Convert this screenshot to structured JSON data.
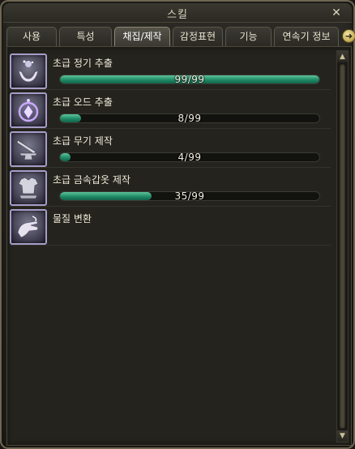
{
  "window": {
    "title": "스킬",
    "close_glyph": "✕"
  },
  "tabs": [
    {
      "label": "사용",
      "active": false
    },
    {
      "label": "특성",
      "active": false
    },
    {
      "label": "채집/제작",
      "active": true
    },
    {
      "label": "감정표현",
      "active": false
    },
    {
      "label": "기능",
      "active": false
    },
    {
      "label": "연속기 정보",
      "active": false
    }
  ],
  "tab_arrow_glyph": "➜",
  "skills": [
    {
      "name": "초급 정기 추출",
      "progress_text": "99/99",
      "level": 99,
      "max": 99,
      "icon": "cupped-hands-icon"
    },
    {
      "name": "초급 오드 추출",
      "progress_text": "8/99",
      "level": 8,
      "max": 99,
      "icon": "odd-crystal-icon"
    },
    {
      "name": "초급 무기 제작",
      "progress_text": "4/99",
      "level": 4,
      "max": 99,
      "icon": "anvil-sword-icon"
    },
    {
      "name": "초급 금속갑옷 제작",
      "progress_text": "35/99",
      "level": 35,
      "max": 99,
      "icon": "plate-armor-icon"
    },
    {
      "name": "물질 변환",
      "icon": "hand-transmute-icon"
    }
  ],
  "scrollbar": {
    "up_glyph": "▲",
    "down_glyph": "▼"
  },
  "colors": {
    "bar_fill": "#1f8b67",
    "icon_border": "#a79dc8",
    "frame": "#6f6753"
  }
}
